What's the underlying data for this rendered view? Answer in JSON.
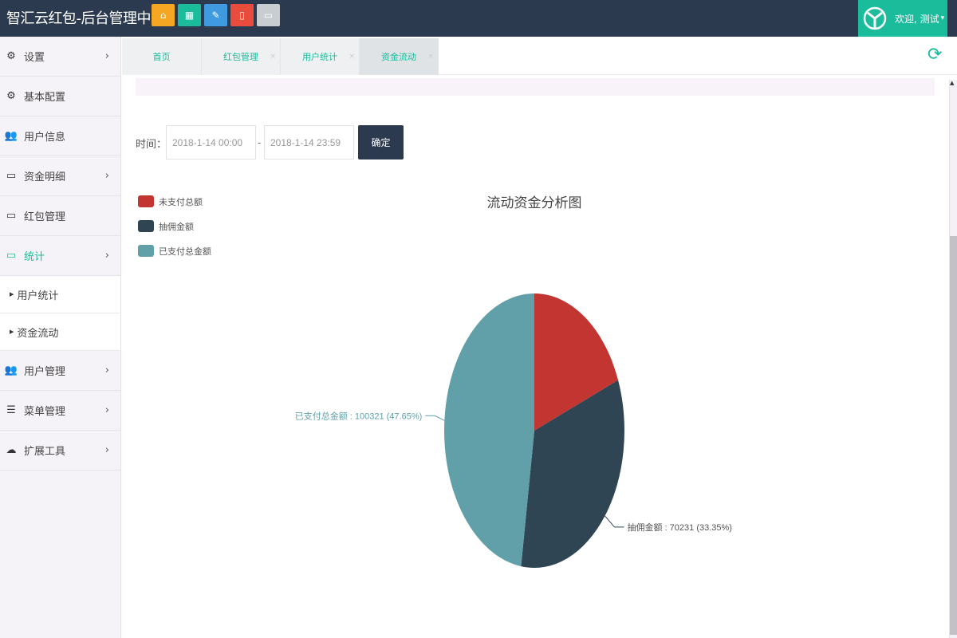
{
  "header": {
    "title": "智汇云红包-后台管理中心",
    "quick_buttons": [
      {
        "icon": "home-icon",
        "color": "#f5a623"
      },
      {
        "icon": "calendar-icon",
        "color": "#1abc9c"
      },
      {
        "icon": "pencil-icon",
        "color": "#3f9ae0"
      },
      {
        "icon": "mobile-icon",
        "color": "#e74c3c"
      },
      {
        "icon": "monitor-icon",
        "color": "#c8cdd2"
      }
    ],
    "user": {
      "welcome": "欢迎, 测试",
      "caret": "▾"
    }
  },
  "sidebar": {
    "items": [
      {
        "label": "设置",
        "icon": "cogs-icon",
        "chevron": "›"
      },
      {
        "label": "基本配置",
        "icon": "cogs-icon",
        "chevron": ""
      },
      {
        "label": "用户信息",
        "icon": "users-icon",
        "chevron": ""
      },
      {
        "label": "资金明细",
        "icon": "desktop-icon",
        "chevron": "›"
      },
      {
        "label": "红包管理",
        "icon": "desktop-icon",
        "chevron": ""
      },
      {
        "label": "统计",
        "icon": "desktop-icon",
        "chevron": "›",
        "active": true
      },
      {
        "label": "用户管理",
        "icon": "users-icon",
        "chevron": "›"
      },
      {
        "label": "菜单管理",
        "icon": "list-icon",
        "chevron": "›"
      },
      {
        "label": "扩展工具",
        "icon": "cloud-icon",
        "chevron": "›"
      }
    ],
    "sub_items": [
      {
        "label": "用户统计",
        "bullet": "▶"
      },
      {
        "label": "资金流动",
        "bullet": "▶"
      }
    ]
  },
  "tabs": [
    {
      "label": "首页",
      "close": ""
    },
    {
      "label": "红包管理",
      "close": "×"
    },
    {
      "label": "用户统计",
      "close": "×"
    },
    {
      "label": "资金流动",
      "close": "×",
      "active": true
    }
  ],
  "filter": {
    "label": "时间：",
    "start": "2018-1-14 00:00",
    "separator": "-",
    "end": "2018-1-14 23:59",
    "confirm": "确定"
  },
  "chart_data": {
    "type": "pie",
    "title": "流动资金分析图",
    "legend_position": "top-left",
    "series": [
      {
        "name": "未支付总额",
        "color": "#c23531",
        "value": 40000,
        "percent": 19.0,
        "label_visible": false
      },
      {
        "name": "抽佣金额",
        "color": "#2f4554",
        "value": 70231,
        "percent": 33.35,
        "label": "抽佣金额 : 70231 (33.35%)",
        "label_visible": true
      },
      {
        "name": "已支付总金额",
        "color": "#61a0a8",
        "value": 100321,
        "percent": 47.65,
        "label": "已支付总金额 : 100321 (47.65%)",
        "label_visible": true
      }
    ]
  }
}
